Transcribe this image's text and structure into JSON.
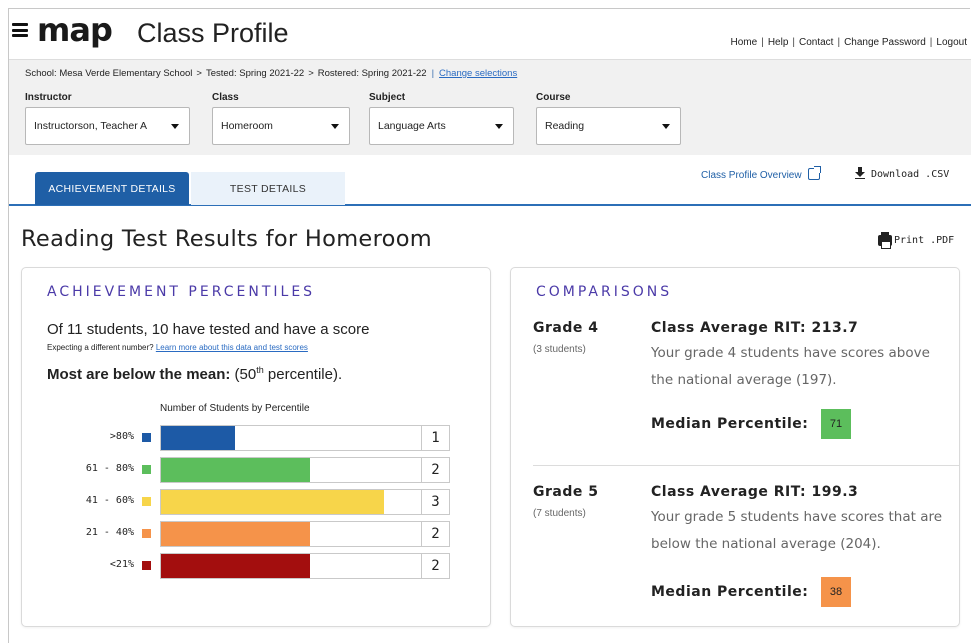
{
  "header": {
    "logo": "map",
    "title": "Class Profile",
    "links": [
      "Home",
      "Help",
      "Contact",
      "Change Password",
      "Logout"
    ]
  },
  "filters": {
    "breadcrumb": {
      "school": "School: Mesa Verde Elementary School",
      "tested": "Tested: Spring 2021-22",
      "rostered": "Rostered: Spring 2021-22",
      "change": "Change selections"
    },
    "instructor": {
      "label": "Instructor",
      "value": "Instructorson, Teacher A"
    },
    "class": {
      "label": "Class",
      "value": "Homeroom"
    },
    "subject": {
      "label": "Subject",
      "value": "Language Arts"
    },
    "course": {
      "label": "Course",
      "value": "Reading"
    }
  },
  "tabs": [
    {
      "label": "ACHIEVEMENT DETAILS",
      "active": true
    },
    {
      "label": "TEST DETAILS",
      "active": false
    }
  ],
  "actions": {
    "overview": "Class Profile Overview",
    "download": "Download .CSV",
    "print": "Print .PDF"
  },
  "main": {
    "title": "Reading Test Results for Homeroom"
  },
  "achievement": {
    "heading": "ACHIEVEMENT PERCENTILES",
    "lead": "Of 11 students, 10 have tested and have a score",
    "sub_prefix": "Expecting a different number?",
    "sub_link": "Learn more about this data and test scores",
    "mean_bold": "Most are below the mean:",
    "mean_rest_a": "(50",
    "mean_sup": "th",
    "mean_rest_b": "percentile)."
  },
  "chart_data": {
    "type": "bar",
    "title": "Number of Students by Percentile",
    "categories": [
      ">80%",
      "61 - 80%",
      "41 - 60%",
      "21 - 40%",
      "<21%"
    ],
    "values": [
      1,
      2,
      3,
      2,
      2
    ],
    "colors": [
      "#1d5aa6",
      "#5cbe5c",
      "#f7d54a",
      "#f5934a",
      "#a30e0e"
    ],
    "xlim": [
      0,
      3.5
    ]
  },
  "comparisons": {
    "heading": "COMPARISONS",
    "grades": [
      {
        "grade": "Grade 4",
        "students": "(3 students)",
        "avg": "Class Average RIT: 213.7",
        "desc": "Your grade 4 students have scores above the national average (197).",
        "median_label": "Median Percentile:",
        "median": "71",
        "median_color": "#5cbe5c"
      },
      {
        "grade": "Grade 5",
        "students": "(7 students)",
        "avg": "Class Average RIT: 199.3",
        "desc": "Your grade 5 students have scores that are below the national average (204).",
        "median_label": "Median Percentile:",
        "median": "38",
        "median_color": "#f5934a"
      }
    ]
  }
}
